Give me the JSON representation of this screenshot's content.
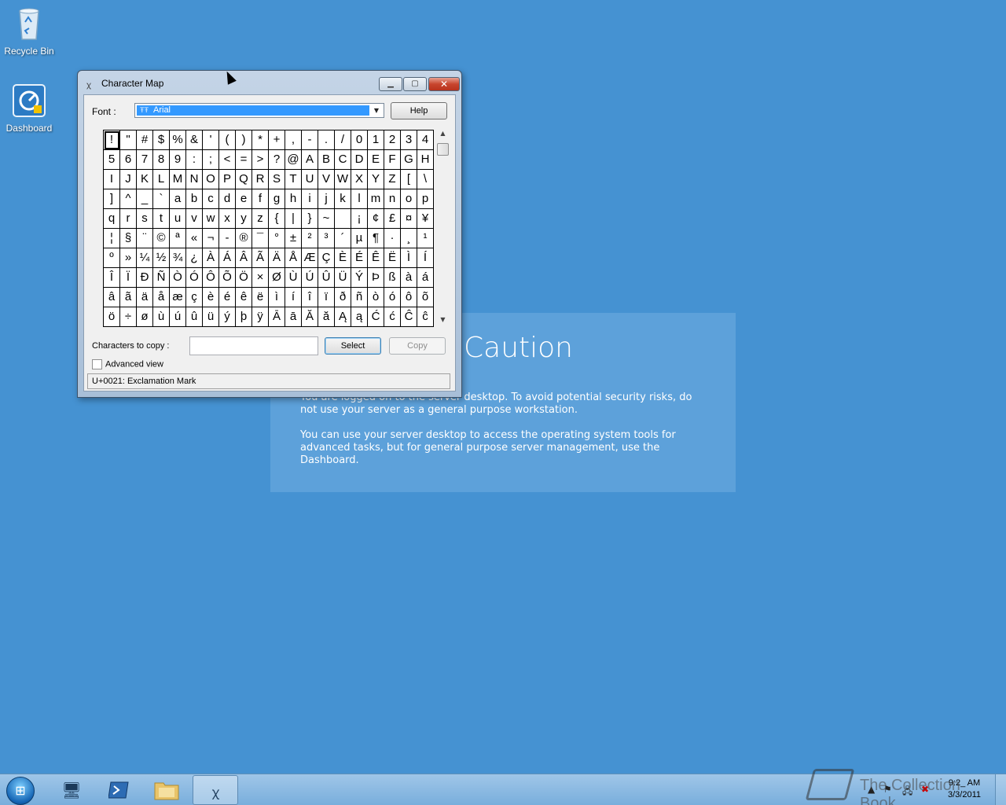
{
  "desktop": {
    "icons": [
      {
        "label": "Recycle Bin"
      },
      {
        "label": "Dashboard"
      }
    ],
    "caution": {
      "title": "Caution",
      "p1": "You are logged on to the server desktop. To avoid potential security risks, do not use your server as a general purpose workstation.",
      "p2": "You can use your server desktop to access the operating system tools for advanced tasks, but for general purpose server management, use the Dashboard."
    }
  },
  "window": {
    "title": "Character Map",
    "font_label": "Font :",
    "font_value": "Arial",
    "font_icon": "truetype-font-icon",
    "help_label": "Help",
    "chars": [
      "!",
      "\"",
      "#",
      "$",
      "%",
      "&",
      "'",
      "(",
      ")",
      "*",
      "+",
      ",",
      "-",
      ".",
      "/",
      "0",
      "1",
      "2",
      "3",
      "4",
      "5",
      "6",
      "7",
      "8",
      "9",
      ":",
      ";",
      "<",
      "=",
      ">",
      "?",
      "@",
      "A",
      "B",
      "C",
      "D",
      "E",
      "F",
      "G",
      "H",
      "I",
      "J",
      "K",
      "L",
      "M",
      "N",
      "O",
      "P",
      "Q",
      "R",
      "S",
      "T",
      "U",
      "V",
      "W",
      "X",
      "Y",
      "Z",
      "[",
      "\\",
      "]",
      "^",
      "_",
      "`",
      "a",
      "b",
      "c",
      "d",
      "e",
      "f",
      "g",
      "h",
      "i",
      "j",
      "k",
      "l",
      "m",
      "n",
      "o",
      "p",
      "q",
      "r",
      "s",
      "t",
      "u",
      "v",
      "w",
      "x",
      "y",
      "z",
      "{",
      "|",
      "}",
      "~",
      " ",
      "¡",
      "¢",
      "£",
      "¤",
      "¥",
      "¦",
      "§",
      "¨",
      "©",
      "ª",
      "«",
      "¬",
      "-",
      "®",
      "¯",
      "°",
      "±",
      "²",
      "³",
      "´",
      "µ",
      "¶",
      "·",
      "¸",
      "¹",
      "º",
      "»",
      "¼",
      "½",
      "¾",
      "¿",
      "À",
      "Á",
      "Â",
      "Ã",
      "Ä",
      "Å",
      "Æ",
      "Ç",
      "È",
      "É",
      "Ê",
      "Ë",
      "Ì",
      "Í",
      "Î",
      "Ï",
      "Ð",
      "Ñ",
      "Ò",
      "Ó",
      "Ô",
      "Õ",
      "Ö",
      "×",
      "Ø",
      "Ù",
      "Ú",
      "Û",
      "Ü",
      "Ý",
      "Þ",
      "ß",
      "à",
      "á",
      "â",
      "ã",
      "ä",
      "å",
      "æ",
      "ç",
      "è",
      "é",
      "ê",
      "ë",
      "ì",
      "í",
      "î",
      "ï",
      "ð",
      "ñ",
      "ò",
      "ó",
      "ô",
      "õ",
      "ö",
      "÷",
      "ø",
      "ù",
      "ú",
      "û",
      "ü",
      "ý",
      "þ",
      "ÿ",
      "Ā",
      "ā",
      "Ă",
      "ă",
      "Ą",
      "ą",
      "Ć",
      "ć",
      "Ĉ",
      "ĉ"
    ],
    "selected_index": 0,
    "copy_label": "Characters to copy :",
    "copy_value": "",
    "select_label": "Select",
    "copy_button_label": "Copy",
    "advanced_label": "Advanced view",
    "advanced_checked": false,
    "status": "U+0021: Exclamation Mark"
  },
  "taskbar": {
    "items": [
      {
        "icon": "server-manager-icon"
      },
      {
        "icon": "powershell-icon"
      },
      {
        "icon": "folder-icon"
      },
      {
        "icon": "character-map-icon",
        "active": true
      }
    ],
    "clock_time": "9:2_ AM",
    "clock_date": "3/3/2011"
  },
  "watermark": "The Collection Book"
}
